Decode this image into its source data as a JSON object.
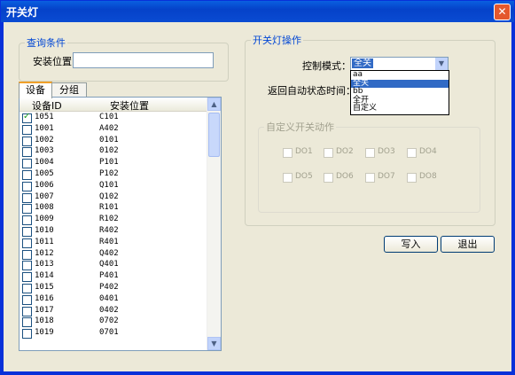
{
  "window": {
    "title": "开关灯"
  },
  "query": {
    "legend": "查询条件",
    "location_label": "安装位置",
    "location_value": ""
  },
  "tabs": [
    {
      "label": "设备"
    },
    {
      "label": "分组"
    }
  ],
  "device_list": {
    "columns": [
      "设备ID",
      "安装位置"
    ],
    "rows": [
      {
        "id": "1051",
        "loc": "C101",
        "checked": true
      },
      {
        "id": "1001",
        "loc": "A402",
        "checked": false
      },
      {
        "id": "1002",
        "loc": "0101",
        "checked": false
      },
      {
        "id": "1003",
        "loc": "0102",
        "checked": false
      },
      {
        "id": "1004",
        "loc": "P101",
        "checked": false
      },
      {
        "id": "1005",
        "loc": "P102",
        "checked": false
      },
      {
        "id": "1006",
        "loc": "Q101",
        "checked": false
      },
      {
        "id": "1007",
        "loc": "Q102",
        "checked": false
      },
      {
        "id": "1008",
        "loc": "R101",
        "checked": false
      },
      {
        "id": "1009",
        "loc": "R102",
        "checked": false
      },
      {
        "id": "1010",
        "loc": "R402",
        "checked": false
      },
      {
        "id": "1011",
        "loc": "R401",
        "checked": false
      },
      {
        "id": "1012",
        "loc": "Q402",
        "checked": false
      },
      {
        "id": "1013",
        "loc": "Q401",
        "checked": false
      },
      {
        "id": "1014",
        "loc": "P401",
        "checked": false
      },
      {
        "id": "1015",
        "loc": "P402",
        "checked": false
      },
      {
        "id": "1016",
        "loc": "0401",
        "checked": false
      },
      {
        "id": "1017",
        "loc": "0402",
        "checked": false
      },
      {
        "id": "1018",
        "loc": "0702",
        "checked": false
      },
      {
        "id": "1019",
        "loc": "0701",
        "checked": false
      }
    ]
  },
  "switch_ops": {
    "legend": "开关灯操作",
    "mode_label": "控制模式：",
    "mode_value": "全关",
    "mode_options": [
      "aa",
      "全关",
      "bb",
      "全开",
      "自定义"
    ],
    "return_label": "返回自动状态时间：",
    "custom_legend": "自定义开关动作",
    "outputs": [
      "DO1",
      "DO2",
      "DO3",
      "DO4",
      "DO5",
      "DO6",
      "DO7",
      "DO8"
    ]
  },
  "buttons": {
    "write": "写入",
    "exit": "退出"
  }
}
